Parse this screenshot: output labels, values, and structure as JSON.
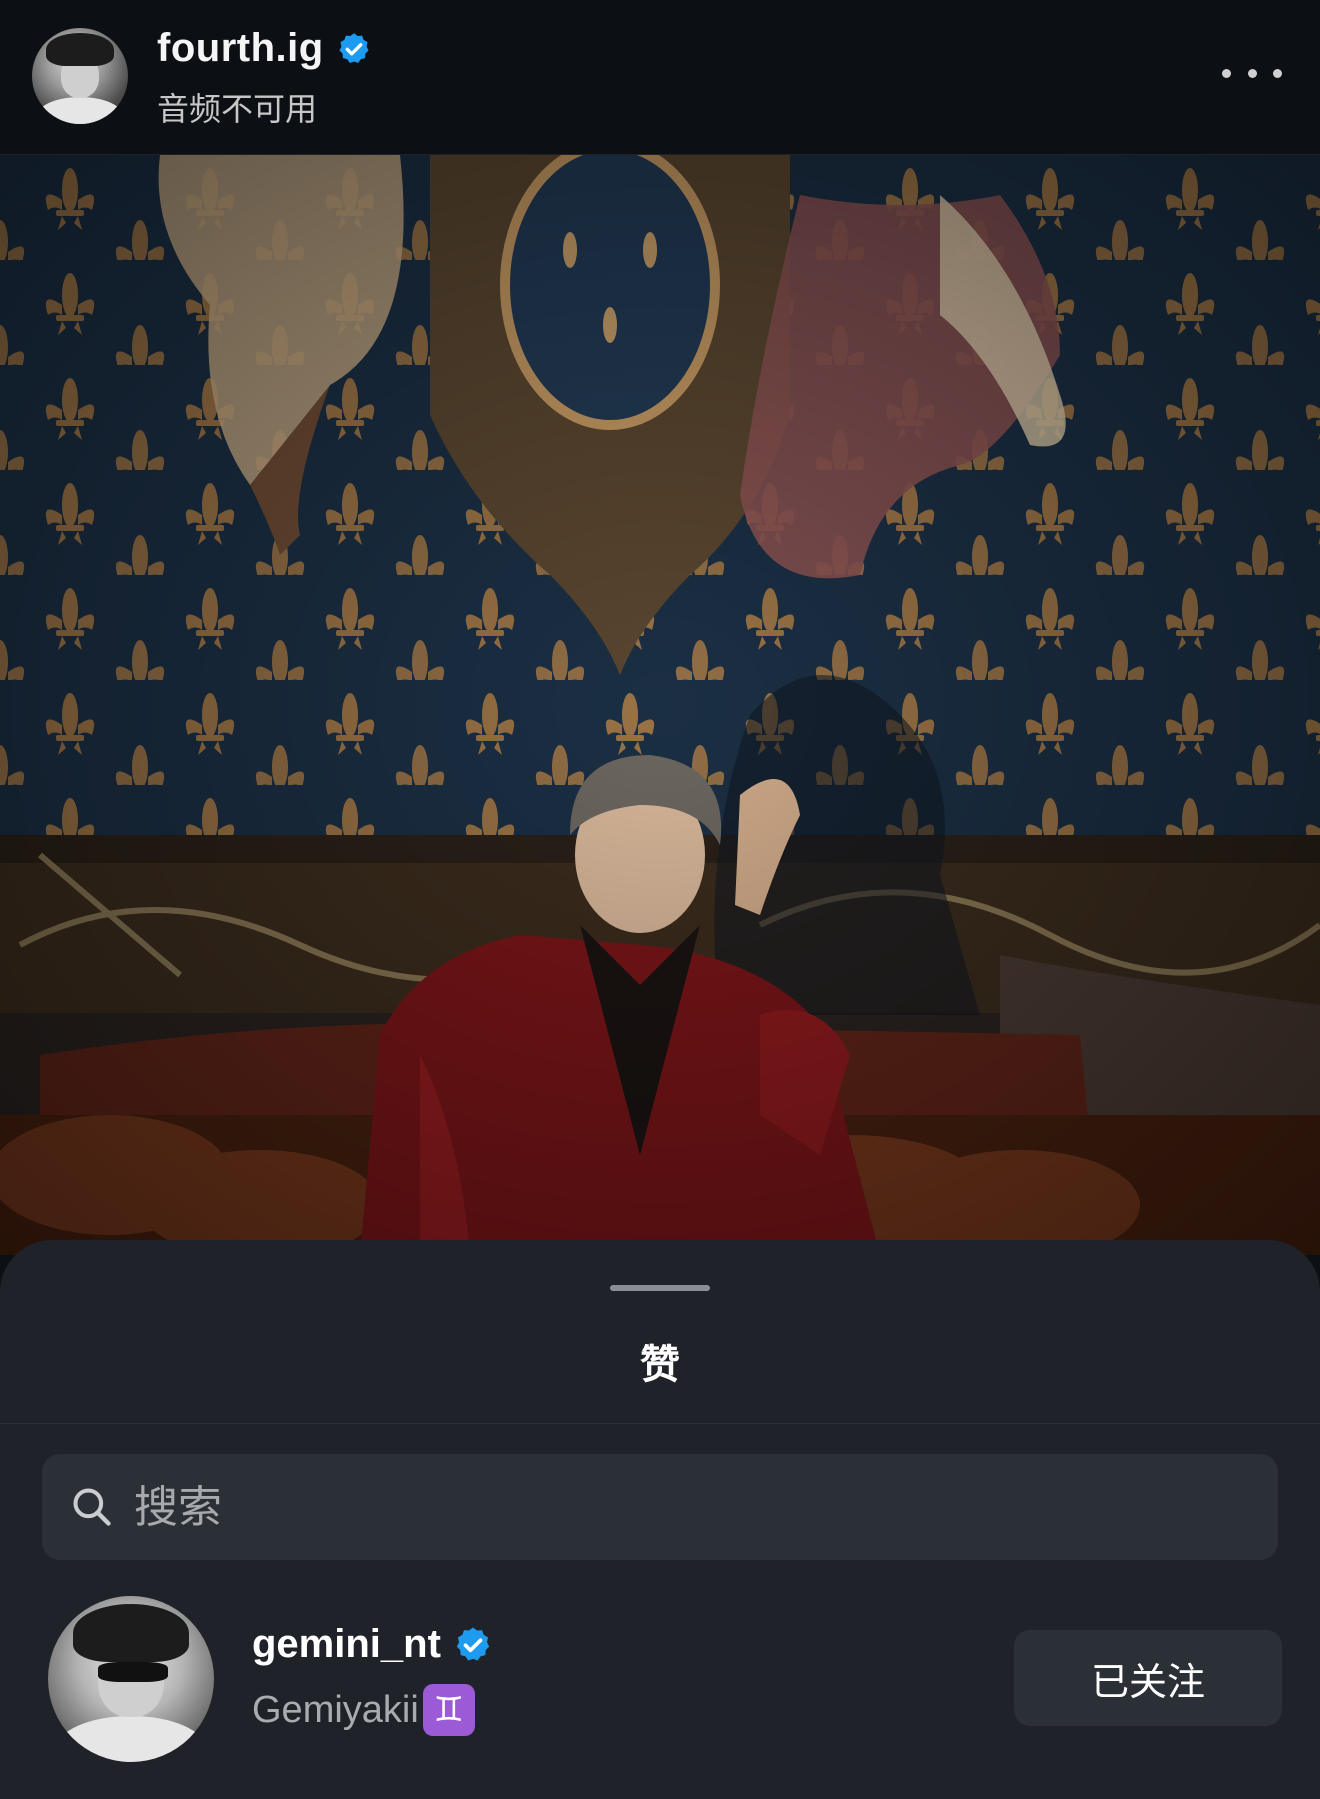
{
  "header": {
    "username": "fourth.ig",
    "subtitle": "音频不可用",
    "more_icon": "more-horizontal-icon"
  },
  "sheet": {
    "title": "赞",
    "search": {
      "placeholder": "搜索",
      "value": ""
    },
    "users": [
      {
        "username": "gemini_nt",
        "verified": true,
        "full_name": "Gemiyakii",
        "emoji": "♊",
        "button_label": "已关注"
      }
    ]
  },
  "colors": {
    "background": "#0c1014",
    "sheet": "#1f2329",
    "verified": "#1d9bf0",
    "tapestry_blue": "#1d3247",
    "tapestry_gold": "#b8874f",
    "jacket_red": "#7a1518"
  }
}
